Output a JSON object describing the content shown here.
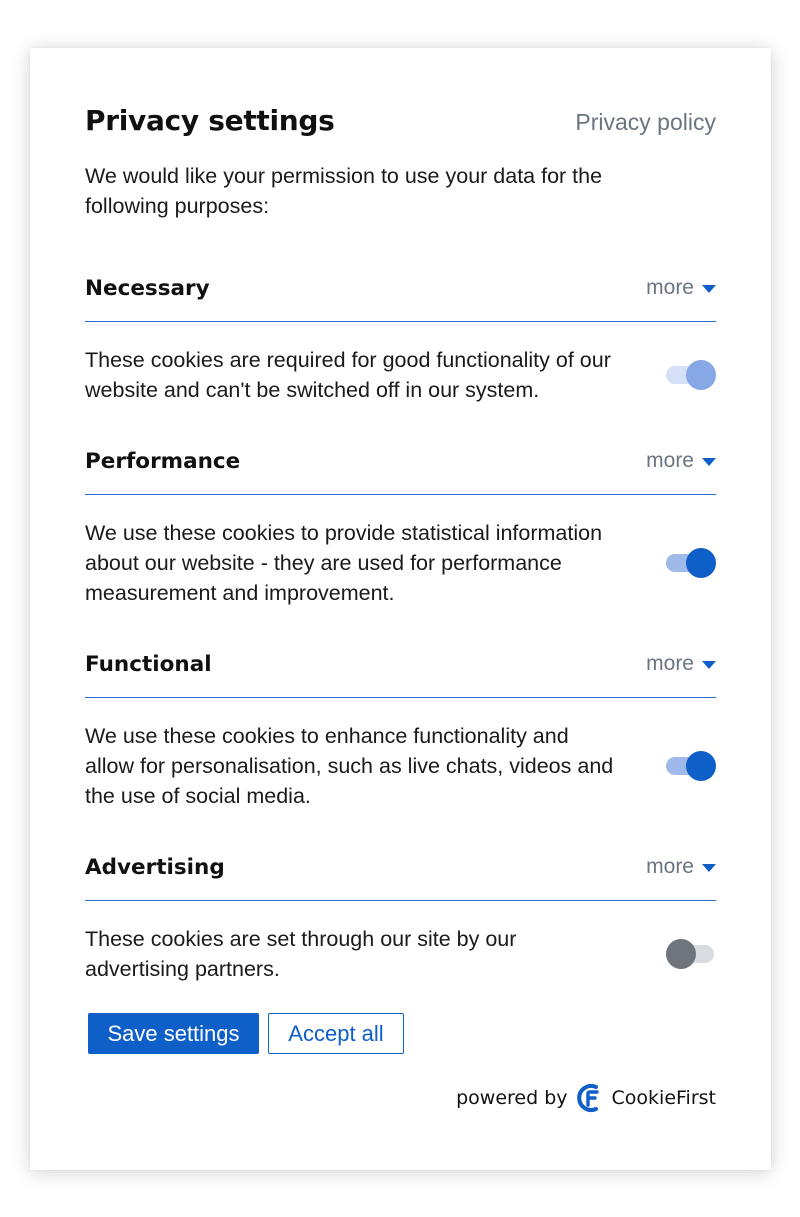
{
  "header": {
    "title": "Privacy settings",
    "policy_link": "Privacy policy"
  },
  "intro": "We would like your permission to use your data for the following purposes:",
  "sections": [
    {
      "title": "Necessary",
      "more": "more",
      "description": "These cookies are required for good functionality of our website and can't be switched off in our system.",
      "toggle_state": "on-disabled"
    },
    {
      "title": "Performance",
      "more": "more",
      "description": "We use these cookies to provide statistical information about our website - they are used for performance measurement and improvement.",
      "toggle_state": "on"
    },
    {
      "title": "Functional",
      "more": "more",
      "description": "We use these cookies to enhance functionality and allow for personalisation, such as live chats, videos and the use of social media.",
      "toggle_state": "on"
    },
    {
      "title": "Advertising",
      "more": "more",
      "description": "These cookies are set through our site by our advertising partners.",
      "toggle_state": "off"
    }
  ],
  "buttons": {
    "save": "Save settings",
    "accept": "Accept all"
  },
  "footer": {
    "powered_by": "powered by",
    "brand": "CookieFirst",
    "logo_icon": "cookiefirst-logo-icon"
  },
  "colors": {
    "accent": "#0f5fc9",
    "muted_text": "#6b7582",
    "toggle_off_knob": "#6e757d"
  }
}
